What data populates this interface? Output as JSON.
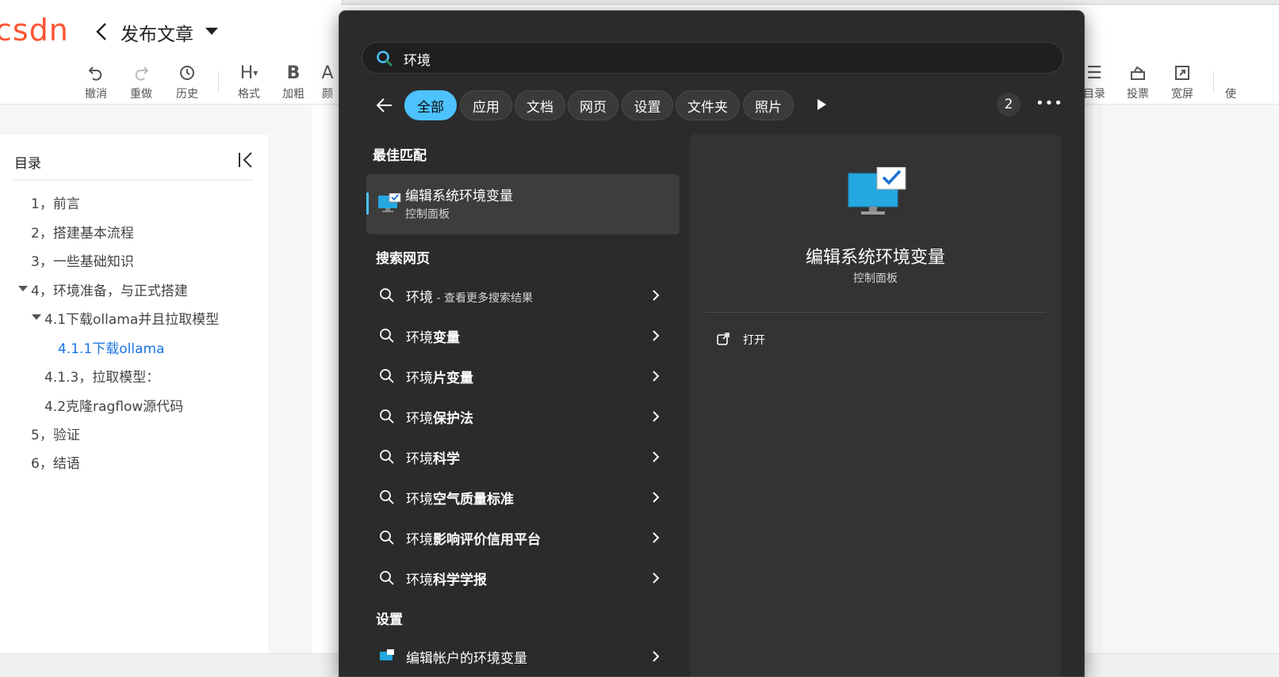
{
  "editor": {
    "logo": "CSDN",
    "title": "发布文章",
    "toolbar": [
      {
        "icon": "undo-icon",
        "label": "撤消"
      },
      {
        "icon": "redo-icon",
        "label": "重做"
      },
      {
        "icon": "history-icon",
        "label": "历史"
      },
      {
        "icon": "heading-icon",
        "label": "格式"
      },
      {
        "icon": "bold-icon",
        "label": "加粗"
      },
      {
        "icon": "color-icon",
        "label": "颜"
      }
    ],
    "toolbar_right": [
      {
        "icon": "toc-icon",
        "label": "目录"
      },
      {
        "icon": "vote-icon",
        "label": "投票"
      },
      {
        "icon": "widescreen-icon",
        "label": "宽屏"
      },
      {
        "icon": "more-icon",
        "label": "使"
      }
    ],
    "toc": {
      "heading": "目录",
      "items": [
        "1，前言",
        "2，搭建基本流程",
        "3，一些基础知识",
        "4，环境准备，与正式搭建",
        "4.1下载ollama并且拉取模型",
        "4.1.1下载ollama",
        "4.1.3，拉取模型：",
        "4.2克隆ragflow源代码",
        "5，验证",
        "6，结语"
      ]
    }
  },
  "search": {
    "query": "环境",
    "filters": [
      "全部",
      "应用",
      "文档",
      "网页",
      "设置",
      "文件夹",
      "照片"
    ],
    "active_filter": "全部",
    "badge": "2",
    "best_match_title": "最佳匹配",
    "best_match": {
      "title": "编辑系统环境变量",
      "subtitle": "控制面板"
    },
    "web_title": "搜索网页",
    "web_results": [
      {
        "prefix": "环境",
        "bold": "",
        "hint": " - 查看更多搜索结果"
      },
      {
        "prefix": "环境",
        "bold": "变量",
        "hint": ""
      },
      {
        "prefix": "环境",
        "bold": "片变量",
        "hint": ""
      },
      {
        "prefix": "环境",
        "bold": "保护法",
        "hint": ""
      },
      {
        "prefix": "环境",
        "bold": "科学",
        "hint": ""
      },
      {
        "prefix": "环境",
        "bold": "空气质量标准",
        "hint": ""
      },
      {
        "prefix": "环境",
        "bold": "影响评价信用平台",
        "hint": ""
      },
      {
        "prefix": "环境",
        "bold": "科学学报",
        "hint": ""
      }
    ],
    "settings_title": "设置",
    "settings_results": [
      {
        "title": "编辑帐户的环境变量"
      }
    ],
    "detail": {
      "title": "编辑系统环境变量",
      "subtitle": "控制面板",
      "action": "打开"
    }
  },
  "colors": {
    "accent": "#4cc2ff",
    "csdn_brand": "#fc5531",
    "toc_active": "#1b74e4",
    "flyout_bg": "#2b2b2b"
  }
}
